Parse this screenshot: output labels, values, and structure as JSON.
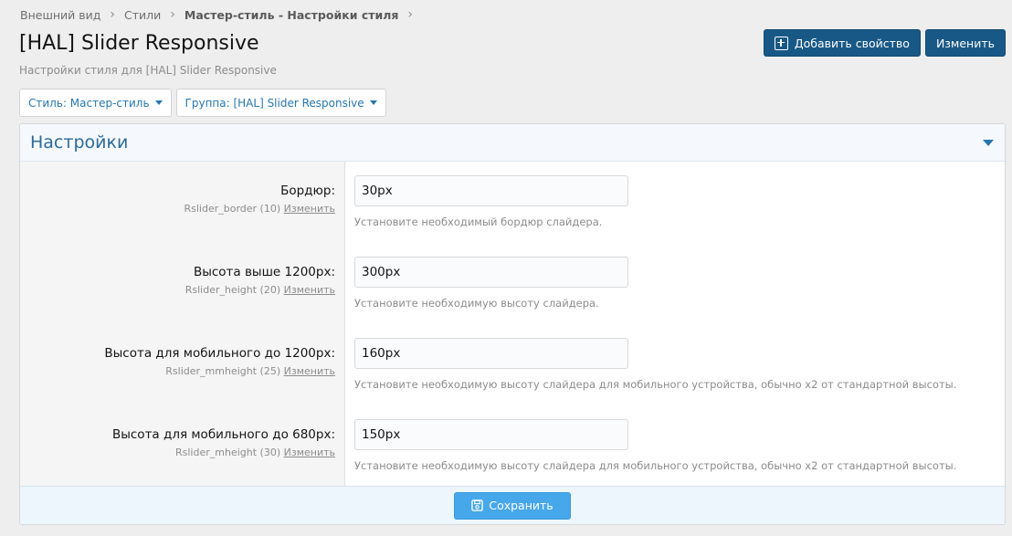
{
  "breadcrumb": [
    "Внешний вид",
    "Стили",
    "Мастер-стиль - Настройки стиля"
  ],
  "page": {
    "title": "[HAL] Slider Responsive",
    "description": "Настройки стиля для [HAL] Slider Responsive"
  },
  "toolbar": {
    "add_property_label": "Добавить свойство",
    "edit_label": "Изменить"
  },
  "filters": {
    "style_label": "Стиль: Мастер-стиль",
    "group_label": "Группа: [HAL] Slider Responsive"
  },
  "panel": {
    "title": "Настройки",
    "save_label": "Сохранить"
  },
  "settings": [
    {
      "label": "Бордюр:",
      "key": "Rslider_border (10)",
      "edit": "Изменить",
      "value": "30px",
      "hint": "Установите необходимый бордюр слайдера."
    },
    {
      "label": "Высота выше 1200px:",
      "key": "Rslider_height (20)",
      "edit": "Изменить",
      "value": "300px",
      "hint": "Установите необходимую высоту слайдера."
    },
    {
      "label": "Высота для мобильного до 1200px:",
      "key": "Rslider_mmheight (25)",
      "edit": "Изменить",
      "value": "160px",
      "hint": "Установите необходимую высоту слайдера для мобильного устройства, обычно x2 от стандартной высоты."
    },
    {
      "label": "Высота для мобильного до 680px:",
      "key": "Rslider_mheight (30)",
      "edit": "Изменить",
      "value": "150px",
      "hint": "Установите необходимую высоту слайдера для мобильного устройства, обычно x2 от стандартной высоты."
    }
  ],
  "colors": {
    "primary": "#185886",
    "link": "#2577b1",
    "panel_title": "#2c6a99",
    "save_button": "#47a7eb"
  },
  "icons": {
    "breadcrumb_separator": "chevron-right-icon",
    "add_property": "plus-square-icon",
    "dropdown": "caret-down-icon",
    "collapse": "caret-down-icon",
    "save": "floppy-disk-icon"
  }
}
